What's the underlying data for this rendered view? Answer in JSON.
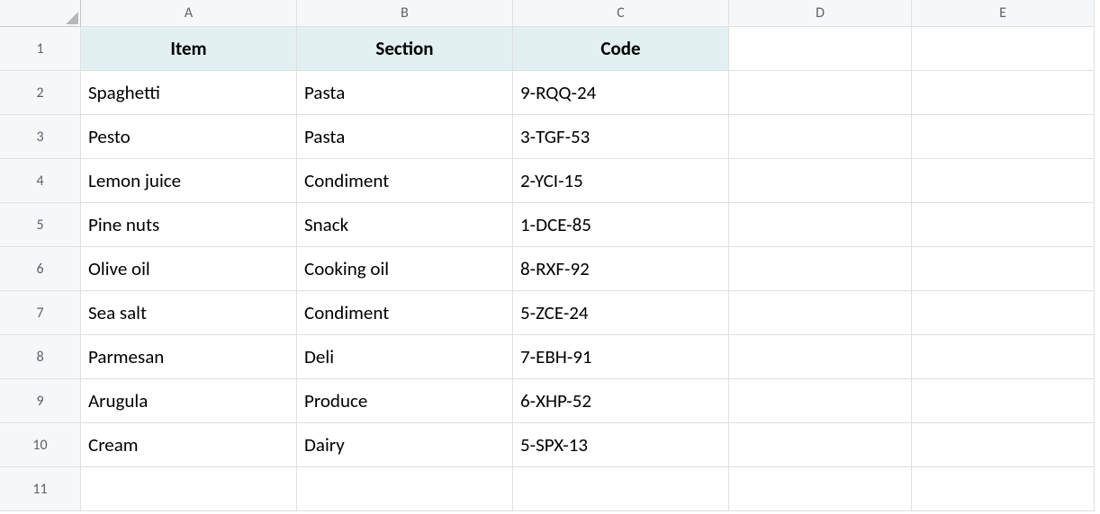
{
  "columns": [
    "A",
    "B",
    "C",
    "D",
    "E"
  ],
  "rows": [
    "1",
    "2",
    "3",
    "4",
    "5",
    "6",
    "7",
    "8",
    "9",
    "10",
    "11"
  ],
  "headers": {
    "item": "Item",
    "section": "Section",
    "code": "Code"
  },
  "data": [
    {
      "item": "Spaghetti",
      "section": "Pasta",
      "code": "9-RQQ-24"
    },
    {
      "item": "Pesto",
      "section": "Pasta",
      "code": "3-TGF-53"
    },
    {
      "item": "Lemon juice",
      "section": "Condiment",
      "code": "2-YCI-15"
    },
    {
      "item": "Pine nuts",
      "section": "Snack",
      "code": "1-DCE-85"
    },
    {
      "item": "Olive oil",
      "section": "Cooking oil",
      "code": "8-RXF-92"
    },
    {
      "item": "Sea salt",
      "section": "Condiment",
      "code": "5-ZCE-24"
    },
    {
      "item": "Parmesan",
      "section": "Deli",
      "code": "7-EBH-91"
    },
    {
      "item": "Arugula",
      "section": "Produce",
      "code": "6-XHP-52"
    },
    {
      "item": "Cream",
      "section": "Dairy",
      "code": "5-SPX-13"
    }
  ],
  "chart_data": {
    "type": "table",
    "columns": [
      "Item",
      "Section",
      "Code"
    ],
    "rows": [
      [
        "Spaghetti",
        "Pasta",
        "9-RQQ-24"
      ],
      [
        "Pesto",
        "Pasta",
        "3-TGF-53"
      ],
      [
        "Lemon juice",
        "Condiment",
        "2-YCI-15"
      ],
      [
        "Pine nuts",
        "Snack",
        "1-DCE-85"
      ],
      [
        "Olive oil",
        "Cooking oil",
        "8-RXF-92"
      ],
      [
        "Sea salt",
        "Condiment",
        "5-ZCE-24"
      ],
      [
        "Parmesan",
        "Deli",
        "7-EBH-91"
      ],
      [
        "Arugula",
        "Produce",
        "6-XHP-52"
      ],
      [
        "Cream",
        "Dairy",
        "5-SPX-13"
      ]
    ]
  }
}
